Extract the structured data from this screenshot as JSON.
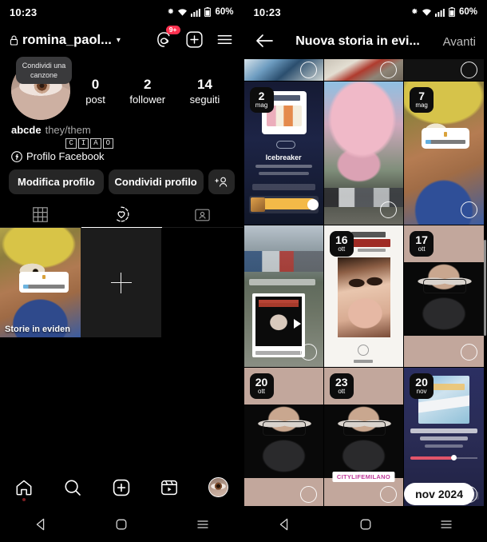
{
  "left": {
    "statusbar": {
      "time": "10:23",
      "battery": "60%"
    },
    "header": {
      "username": "romina_paol...",
      "lock_icon": "lock-icon",
      "chevron": "▾",
      "threads_badge": "9+"
    },
    "tooltip_song": "Condividi una canzone",
    "stats": [
      {
        "num": "0",
        "label": "post"
      },
      {
        "num": "2",
        "label": "follower"
      },
      {
        "num": "14",
        "label": "seguiti"
      }
    ],
    "bio": {
      "name": "abcde",
      "pronouns": "they/them",
      "ciao_letters": [
        "C",
        "I",
        "A",
        "O"
      ],
      "facebook_label": "Profilo Facebook"
    },
    "buttons": {
      "edit_profile": "Modifica profilo",
      "share_profile": "Condividi profilo",
      "add_person_icon": "add-person-icon"
    },
    "tabs": [
      {
        "name": "grid-tab",
        "icon": "grid-icon",
        "active": false
      },
      {
        "name": "highlights-tab",
        "icon": "heart-circle-icon",
        "active": true
      },
      {
        "name": "tagged-tab",
        "icon": "tagged-person-icon",
        "active": false
      }
    ],
    "highlights": {
      "first_label": "Storie in eviden",
      "add_label": "+"
    },
    "bottom_nav": [
      {
        "name": "home",
        "icon": "home-icon"
      },
      {
        "name": "search",
        "icon": "search-icon"
      },
      {
        "name": "create",
        "icon": "plus-square-icon"
      },
      {
        "name": "reels",
        "icon": "reels-icon"
      },
      {
        "name": "profile",
        "icon": "avatar-icon"
      }
    ]
  },
  "right": {
    "statusbar": {
      "time": "10:23",
      "battery": "60%"
    },
    "header": {
      "back_icon": "back-arrow-icon",
      "title": "Nuova storia in evi...",
      "next_label": "Avanti"
    },
    "date_pill": "nov 2024",
    "stories": [
      {
        "day": "",
        "month": "",
        "kind": "beach"
      },
      {
        "day": "",
        "month": "",
        "kind": "wall"
      },
      {
        "day": "",
        "month": "",
        "kind": "dark"
      },
      {
        "day": "2",
        "month": "mag",
        "kind": "spotify-icebreaker"
      },
      {
        "day": "",
        "month": "",
        "kind": "blossom"
      },
      {
        "day": "7",
        "month": "mag",
        "kind": "vangogh"
      },
      {
        "day": "",
        "month": "",
        "kind": "street-americanpsycho"
      },
      {
        "day": "16",
        "month": "ott",
        "kind": "book-anna-karenina"
      },
      {
        "day": "17",
        "month": "ott",
        "kind": "portrait"
      },
      {
        "day": "20",
        "month": "ott",
        "kind": "portrait"
      },
      {
        "day": "23",
        "month": "ott",
        "kind": "portrait-citylife"
      },
      {
        "day": "20",
        "month": "nov",
        "kind": "spotify-winter"
      }
    ],
    "citylife_tag": "CITYLIFEMILANO"
  },
  "sysnav": {
    "back": "triangle-back-icon",
    "home": "circle-home-icon",
    "recents": "menu-recents-icon"
  }
}
